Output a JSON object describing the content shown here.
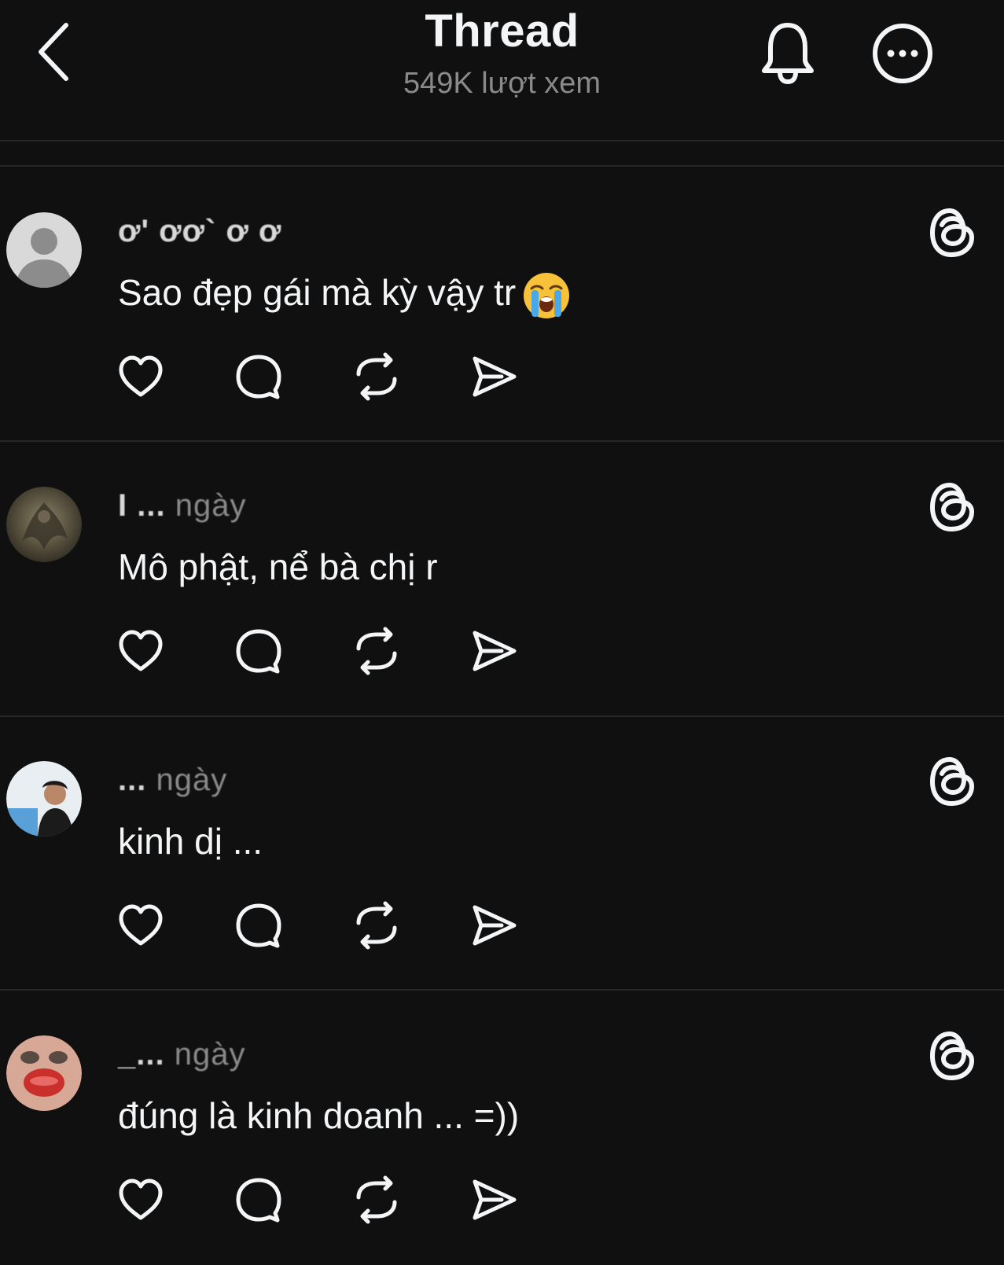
{
  "header": {
    "title": "Thread",
    "views": "549K lượt xem",
    "icons": [
      "chevron-left-icon",
      "bell-icon",
      "more-icon"
    ]
  },
  "comments": [
    {
      "username": "ơ' ơơ` ơ ơ",
      "time": "",
      "text": "Sao đẹp gái mà kỳ vậy tr",
      "emoji": "loudly-crying-face"
    },
    {
      "username": "I ...",
      "time": "ngày",
      "text": "Mô phật, nể bà chị r"
    },
    {
      "username": "...",
      "time": "ngày",
      "text": "kinh dị ..."
    },
    {
      "username": "_...",
      "time": "ngày",
      "text": "đúng là kinh doanh ... =))"
    }
  ],
  "colors": {
    "background": "#101010",
    "text": "#f3f5f7",
    "secondary": "#8a8a8a",
    "divider": "#262626"
  }
}
